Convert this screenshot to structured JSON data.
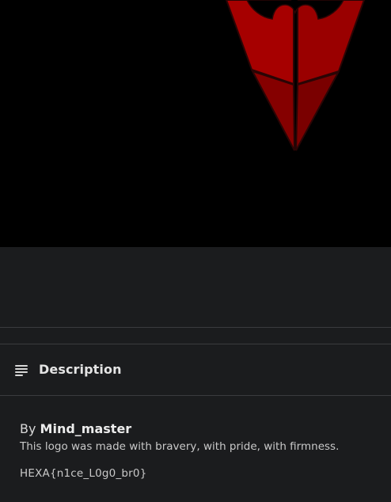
{
  "header_image": {
    "alt": "logo",
    "colors": {
      "background": "#000000",
      "primary": "#a80000",
      "dark": "#7a0000",
      "outline": "#3b0a0a"
    }
  },
  "description": {
    "icon": "notes-icon",
    "title": "Description",
    "author_prefix": "By",
    "author": "Mind_master",
    "text": "This logo was made with bravery, with pride, with firmness.",
    "flag": "HEXA{n1ce_L0g0_br0}"
  },
  "colors": {
    "panel_background": "#1b1c1e",
    "divider": "#3a3b3e",
    "text_primary": "#e4e4e4",
    "text_secondary": "#c9c9c9"
  }
}
